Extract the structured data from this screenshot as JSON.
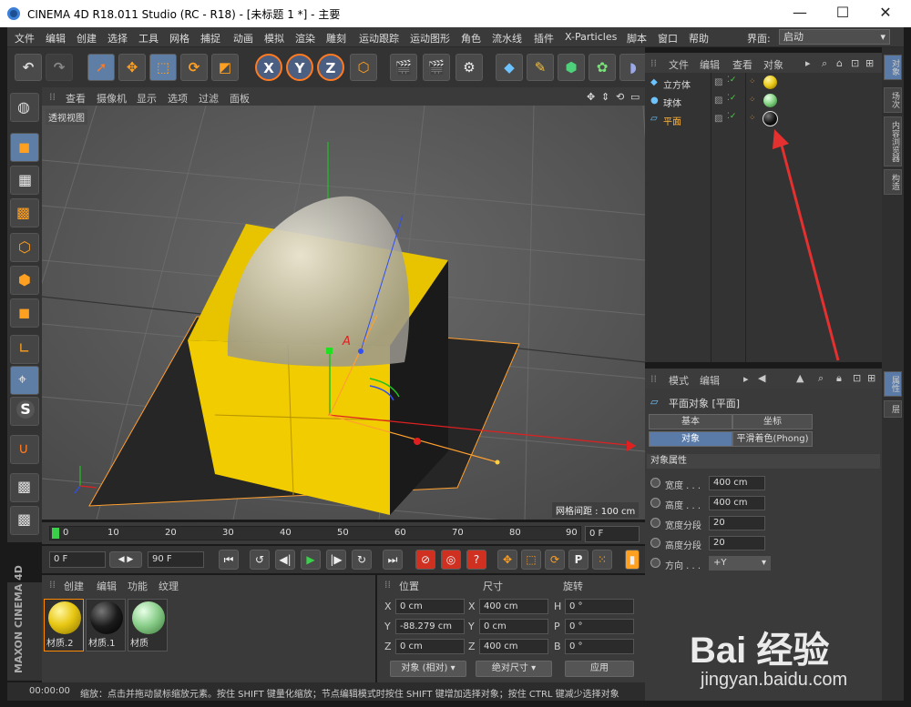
{
  "window": {
    "title": "CINEMA 4D R18.011 Studio (RC - R18) - [未标题 1 *] - 主要",
    "min": "—",
    "max": "☐",
    "close": "✕"
  },
  "menu": [
    "文件",
    "编辑",
    "创建",
    "选择",
    "工具",
    "网格",
    "捕捉",
    "动画",
    "模拟",
    "渲染",
    "雕刻",
    "运动跟踪",
    "运动图形",
    "角色",
    "流水线",
    "插件",
    "X-Particles",
    "脚本",
    "窗口",
    "帮助"
  ],
  "layout": {
    "label": "界面:",
    "value": "启动"
  },
  "viewport": {
    "menu": [
      "查看",
      "摄像机",
      "显示",
      "选项",
      "过滤",
      "面板"
    ],
    "view_label": "透视视图",
    "grid_info": "网格间距 : 100 cm",
    "axis_label": "A"
  },
  "timeline": {
    "ticks": [
      "0",
      "10",
      "20",
      "30",
      "40",
      "50",
      "60",
      "70",
      "80",
      "90"
    ],
    "current": 0,
    "end_field": "0 F"
  },
  "playback": {
    "start": "0 F",
    "end": "90 F"
  },
  "materials": {
    "menu": [
      "创建",
      "编辑",
      "功能",
      "纹理"
    ],
    "items": [
      {
        "name": "材质.2",
        "color": "#e8c814"
      },
      {
        "name": "材质.1",
        "color": "#1a1a1a"
      },
      {
        "name": "材质",
        "color": "#8ed08e"
      }
    ]
  },
  "coords": {
    "headers": [
      "位置",
      "尺寸",
      "旋转"
    ],
    "rows": [
      {
        "axis": "X",
        "pos": "0 cm",
        "size": "400 cm",
        "rl": "H",
        "rot": "0 °"
      },
      {
        "axis": "Y",
        "pos": "-88.279 cm",
        "size": "0 cm",
        "rl": "P",
        "rot": "0 °"
      },
      {
        "axis": "Z",
        "pos": "0 cm",
        "size": "400 cm",
        "rl": "B",
        "rot": "0 °"
      }
    ],
    "mode": "对象 (相对)",
    "size_mode": "绝对尺寸",
    "apply": "应用"
  },
  "status": {
    "time": "00:00:00",
    "text": "缩放：点击并拖动鼠标缩放元素。按住 SHIFT 键量化缩放；节点编辑模式时按住 SHIFT 键增加选择对象；按住 CTRL 键减少选择对象"
  },
  "objects": {
    "menu": [
      "文件",
      "编辑",
      "查看",
      "对象"
    ],
    "items": [
      {
        "name": "立方体",
        "icon": "cube-icon",
        "mat": "#e8c814",
        "selected": false
      },
      {
        "name": "球体",
        "icon": "sphere-icon",
        "mat": "#7fd07f",
        "selected": false
      },
      {
        "name": "平面",
        "icon": "plane-icon",
        "mat": "#1a1a1a",
        "selected": true
      }
    ]
  },
  "attrs": {
    "menu": [
      "模式",
      "编辑"
    ],
    "title": "平面对象 [平面]",
    "tabs": [
      "基本",
      "坐标",
      "对象",
      "平滑着色(Phong)"
    ],
    "section": "对象属性",
    "rows": [
      {
        "label": "宽度 . . .",
        "value": "400 cm"
      },
      {
        "label": "高度 . . .",
        "value": "400 cm"
      },
      {
        "label": "宽度分段",
        "value": "20"
      },
      {
        "label": "高度分段",
        "value": "20"
      },
      {
        "label": "方向 . . .",
        "value": "+Y"
      }
    ]
  },
  "sidetabs": [
    "对象",
    "场次",
    "内容浏览器",
    "构造",
    "属性",
    "层"
  ],
  "brand": "MAXON CINEMA 4D",
  "watermark": {
    "logo": "Bai 经验",
    "url": "jingyan.baidu.com"
  }
}
